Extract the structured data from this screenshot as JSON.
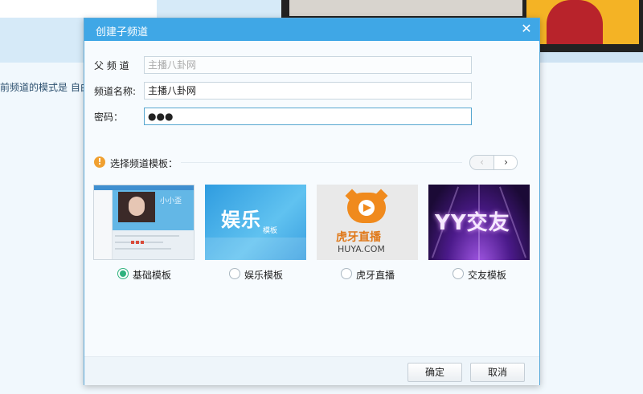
{
  "background": {
    "channel_mode_text": "前频道的模式是 自由"
  },
  "dialog": {
    "title": "创建子频道",
    "close_glyph": "✕",
    "fields": {
      "parent": {
        "label": "父 频 道",
        "value": "主播八卦网"
      },
      "name": {
        "label": "频道名称:",
        "value": "主播八卦网"
      },
      "password": {
        "label": "密码：",
        "value": "●●●"
      }
    },
    "template_section": {
      "warning_glyph": "!",
      "label": "选择频道模板：",
      "prev_glyph": "‹",
      "next_glyph": "›"
    },
    "templates": [
      {
        "label": "基础模板",
        "selected": true,
        "thumb_text": "小小歪"
      },
      {
        "label": "娱乐模板",
        "selected": false,
        "thumb_text": "娱乐",
        "thumb_sub": "模板"
      },
      {
        "label": "虎牙直播",
        "selected": false,
        "thumb_text": "虎牙直播",
        "thumb_sub": "HUYA.COM"
      },
      {
        "label": "交友模板",
        "selected": false,
        "thumb_text": "YY交友"
      }
    ],
    "buttons": {
      "ok": "确定",
      "cancel": "取消"
    }
  },
  "colors": {
    "titlebar": "#3fa7e6",
    "selected_radio": "#2fb27f",
    "warning": "#f0a030"
  }
}
